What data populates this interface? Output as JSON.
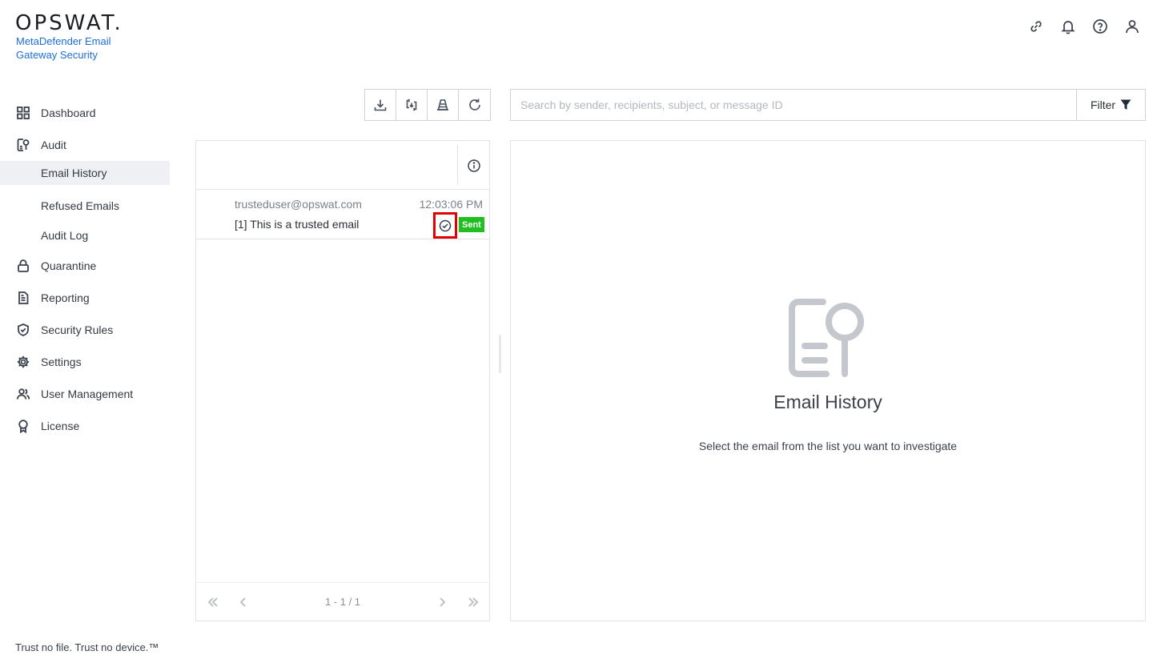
{
  "brand": {
    "logo": "OPSWAT.",
    "product": "MetaDefender Email Gateway Security",
    "tagline": "Trust no file. Trust no device.™"
  },
  "sidebar": {
    "items": [
      {
        "label": "Dashboard",
        "icon": "grid-icon"
      },
      {
        "label": "Audit",
        "icon": "audit-icon"
      },
      {
        "label": "Quarantine",
        "icon": "lock-icon"
      },
      {
        "label": "Reporting",
        "icon": "document-icon"
      },
      {
        "label": "Security Rules",
        "icon": "shield-check-icon"
      },
      {
        "label": "Settings",
        "icon": "gear-icon"
      },
      {
        "label": "User Management",
        "icon": "users-icon"
      },
      {
        "label": "License",
        "icon": "badge-icon"
      }
    ],
    "audit_sub": [
      {
        "label": "Email History",
        "active": true
      },
      {
        "label": "Refused Emails"
      },
      {
        "label": "Audit Log"
      }
    ]
  },
  "search": {
    "placeholder": "Search by sender, recipients, subject, or message ID",
    "value": "",
    "filter_label": "Filter"
  },
  "email_list": {
    "rows": [
      {
        "sender": "trusteduser@opswat.com",
        "time": "12:03:06 PM",
        "subject": "[1] This is a trusted email",
        "status": "Sent",
        "status_color": "#1fbf1f"
      }
    ],
    "pagination": {
      "range": "1 - 1 / 1"
    }
  },
  "detail": {
    "title": "Email History",
    "message": "Select the email from the list you want to investigate"
  }
}
